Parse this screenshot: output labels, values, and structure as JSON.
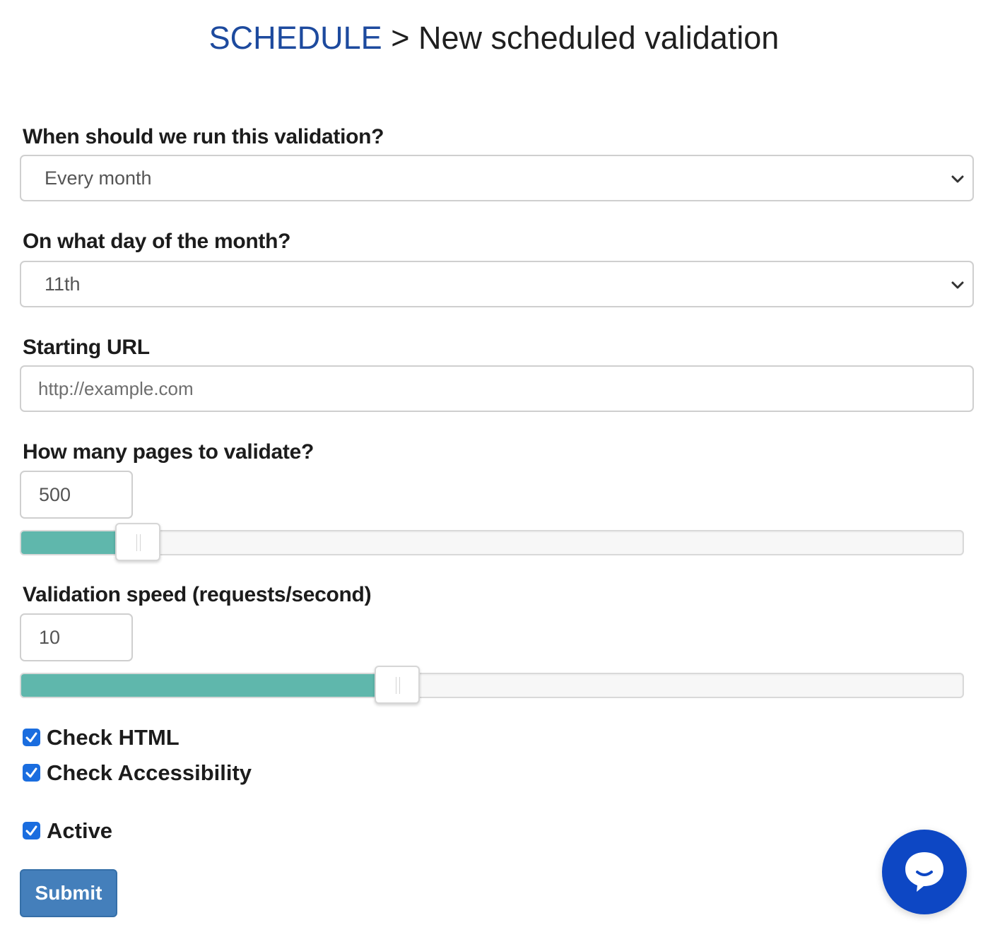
{
  "header": {
    "breadcrumb_root": "SCHEDULE",
    "separator": ">",
    "title": "New scheduled validation"
  },
  "form": {
    "frequency": {
      "label": "When should we run this validation?",
      "selected": "Every month"
    },
    "day_of_month": {
      "label": "On what day of the month?",
      "selected": "11th"
    },
    "starting_url": {
      "label": "Starting URL",
      "placeholder": "http://example.com",
      "value": ""
    },
    "pages": {
      "label": "How many pages to validate?",
      "value": "500",
      "slider_fraction": 0.1
    },
    "speed": {
      "label": "Validation speed (requests/second)",
      "value": "10",
      "slider_fraction": 0.375
    },
    "checkboxes": [
      {
        "label": "Check HTML",
        "checked": true
      },
      {
        "label": "Check Accessibility",
        "checked": true
      },
      {
        "label": "Active",
        "checked": true
      }
    ],
    "submit_label": "Submit"
  },
  "icons": {
    "select_arrow": "chevron-down-icon",
    "checkmark": "checkmark-icon",
    "chat": "chat-icon"
  },
  "colors": {
    "breadcrumb_link": "#1d4a9e",
    "slider_fill": "#5fb7ac",
    "checkbox": "#1a6ddf",
    "submit_button": "#447fbb",
    "chat_bubble": "#0d47c4"
  }
}
